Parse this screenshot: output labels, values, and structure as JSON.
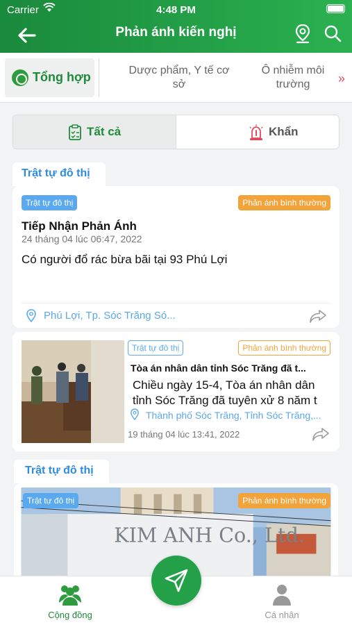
{
  "status": {
    "carrier": "Carrier",
    "time": "4:48 PM"
  },
  "header": {
    "title": "Phản ánh kiến nghị"
  },
  "tabs": {
    "active": "Tổng hợp",
    "items": [
      "Dược phẩm, Y tế cơ sở",
      "Ô nhiễm môi trường"
    ]
  },
  "segment": {
    "left": "Tất cả",
    "right": "Khẩn"
  },
  "cards": [
    {
      "category": "Trật tự đô thị",
      "chip": "Trật tự đô thị",
      "status": "Phản ánh bình thường",
      "title": "Tiếp Nhận Phản Ánh",
      "date": "24 tháng 04 lúc 06:47, 2022",
      "body": "Có người đổ rác bừa bãi tại 93 Phú Lợi",
      "location": "Phú Lợi, Tp. Sóc Trăng Só..."
    },
    {
      "chip": "Trật tự đô thị",
      "status": "Phản ánh bình thường",
      "title": "Tòa án nhân dân tỉnh Sóc Trăng đã t...",
      "body": "Chiều ngày 15-4, Tòa án nhân dân tỉnh Sóc Trăng đã tuyên xử 8 năm t",
      "location": "Thành phố Sóc Trăng, Tỉnh Sóc Trăng,...",
      "date": "19 tháng 04 lúc 13:41, 2022"
    },
    {
      "category": "Trật tự đô thị",
      "chip": "Trật tự đô thị",
      "status": "Phản ánh bình thường",
      "image_text": "KIM ANH Co., Ltd."
    }
  ],
  "tabbar": {
    "community": "Cộng đồng",
    "personal": "Cá nhân"
  }
}
